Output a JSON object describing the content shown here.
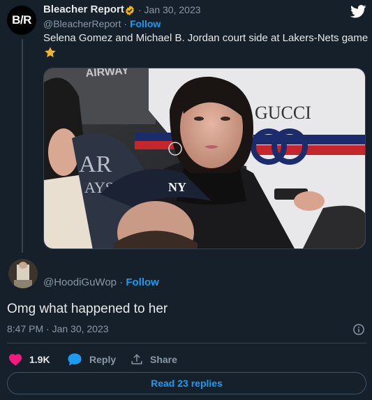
{
  "tweet": {
    "avatar_text": "B/R",
    "author": "Bleacher Report",
    "date": "· Jan 30, 2023",
    "handle": "@BleacherReport",
    "separator": " · ",
    "follow": "Follow",
    "text": "Selena Gomez and Michael B. Jordan court side at Lakers-Nets game",
    "emoji": "star-icon",
    "photo_texts": {
      "arena": "AIRWAY",
      "sign_line1": "AR",
      "sign_line2": "AYS",
      "cap_logo": "NY",
      "shirt_brand": "GUCCI"
    }
  },
  "reply": {
    "handle": "@HoodiGuWop",
    "separator": " · ",
    "follow": "Follow",
    "text": "Omg what happened to her",
    "meta": "8:47 PM · Jan 30, 2023"
  },
  "actions": {
    "likes": "1.9K",
    "reply_label": "Reply",
    "share_label": "Share"
  },
  "read_more": "Read 23 replies",
  "colors": {
    "background": "#15202b",
    "accent": "#1d9bf0",
    "like": "#f91880",
    "muted": "#8b98a5"
  }
}
